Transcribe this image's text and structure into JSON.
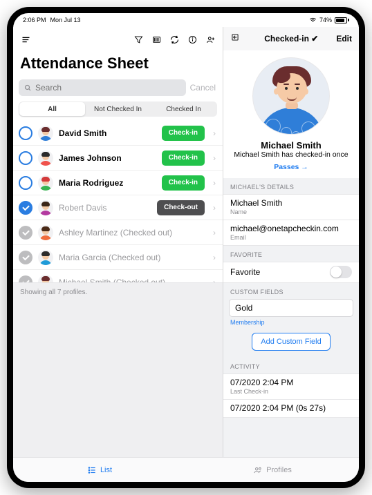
{
  "statusbar": {
    "time": "2:06 PM",
    "date": "Mon Jul 13",
    "battery": "74%"
  },
  "leftToolbar": {},
  "title": "Attendance Sheet",
  "search": {
    "placeholder": "Search",
    "cancel": "Cancel"
  },
  "segments": {
    "all": "All",
    "not": "Not Checked In",
    "in": "Checked In"
  },
  "rows": [
    {
      "name": "David Smith",
      "action": "Check-in",
      "state": "open",
      "btn": "green",
      "shirt": "#2f7ed8",
      "hair": "#6a2d2e"
    },
    {
      "name": "James Johnson",
      "action": "Check-in",
      "state": "open",
      "btn": "green",
      "shirt": "#f0524c",
      "hair": "#2b2b2b"
    },
    {
      "name": "Maria Rodriguez",
      "action": "Check-in",
      "state": "open",
      "btn": "green",
      "shirt": "#37b351",
      "hair": "#d33a3a"
    },
    {
      "name": "Robert Davis",
      "action": "Check-out",
      "state": "checked",
      "btn": "dark",
      "shirt": "#b33aa0",
      "hair": "#3a2618"
    },
    {
      "name": "Ashley Martinez (Checked out)",
      "action": "",
      "state": "gray",
      "shirt": "#f06c3c",
      "hair": "#4a2a17"
    },
    {
      "name": "Maria Garcia (Checked out)",
      "action": "",
      "state": "gray",
      "shirt": "#1f9bd8",
      "hair": "#2b2b2b"
    },
    {
      "name": "Michael Smith (Checked out)",
      "action": "",
      "state": "gray",
      "shirt": "#2f7ed8",
      "hair": "#6a2d2e"
    }
  ],
  "listFooter": "Showing all 7 profiles.",
  "tabs": {
    "list": "List",
    "profiles": "Profiles"
  },
  "rightToolbar": {
    "status": "Checked-in ✔",
    "edit": "Edit"
  },
  "profile": {
    "name": "Michael Smith",
    "subtitle": "Michael Smith has checked-in once",
    "passes": "Passes →"
  },
  "details": {
    "header": "MICHAEL'S DETAILS",
    "nameVal": "Michael Smith",
    "nameLabel": "Name",
    "emailVal": "michael@onetapcheckin.com",
    "emailLabel": "Email"
  },
  "favorite": {
    "header": "FAVORITE",
    "label": "Favorite"
  },
  "custom": {
    "header": "CUSTOM FIELDS",
    "value": "Gold",
    "label": "Membership",
    "add": "Add Custom Field"
  },
  "activity": {
    "header": "ACTIVITY",
    "ts": "07/2020 2:04 PM",
    "label": "Last Check-in",
    "ts2": "07/2020 2:04 PM (0s 27s)"
  }
}
